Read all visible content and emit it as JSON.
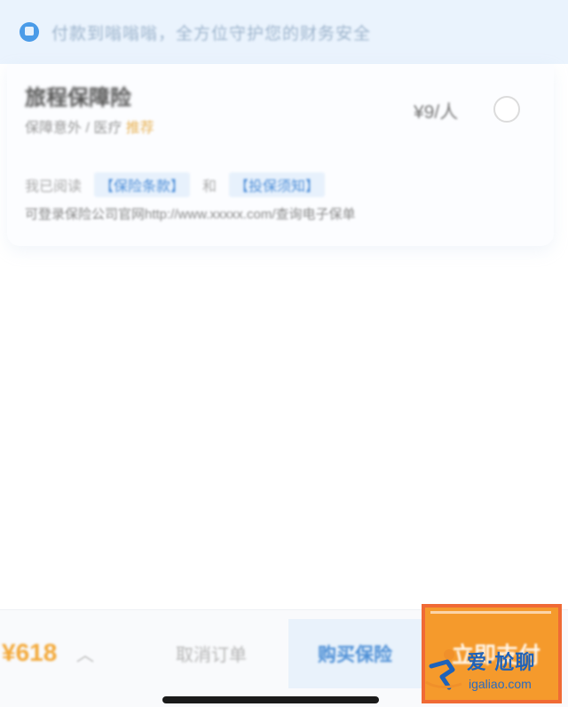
{
  "banner": {
    "icon": "shield-icon",
    "text": "付款到嗡嗡嗡，全方位守护您的财务安全"
  },
  "product": {
    "title": "旅程保障险",
    "subtitle_prefix": "保障意外 / 医疗",
    "subtitle_highlight": "推荐",
    "price_per": "¥9/人",
    "checked": false
  },
  "agreement": {
    "prefix": "我已阅读",
    "link1": "【保险条款】",
    "connector": "和",
    "link2": "【投保须知】",
    "notice": "可登录保险公司官网http://www.xxxxx.com/查询电子保单"
  },
  "bottom": {
    "total": "¥618",
    "chevron": "chevron-up-icon",
    "cancel_label": "取消订单",
    "buy_label": "购买保险",
    "pay_label": "立即支付"
  },
  "watermark": {
    "logo_text": "爱·尬聊",
    "url": "igaliao.com"
  },
  "colors": {
    "accent_orange": "#f59a2c",
    "highlight_border": "#f06a35",
    "link_blue": "#4f8fd8",
    "banner_bg": "#eaf3fd"
  }
}
